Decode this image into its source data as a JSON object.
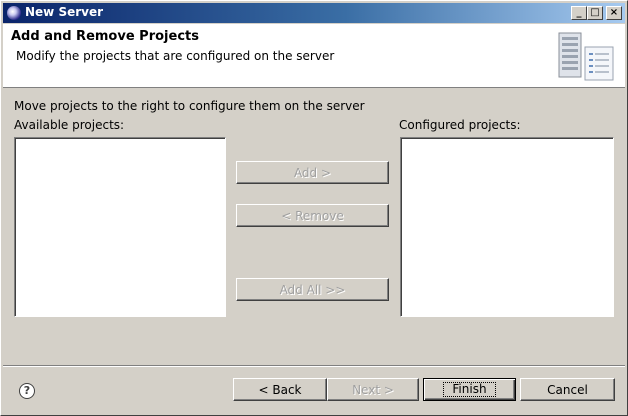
{
  "window": {
    "title": "New Server",
    "controls": {
      "minimize": "_",
      "maximize": "□",
      "close": "×"
    }
  },
  "header": {
    "title": "Add and Remove Projects",
    "description": "Modify the projects that are configured on the server",
    "banner_icon": "server-icon"
  },
  "main": {
    "instruction": "Move projects to the right to configure them on the server",
    "available_label": "Available projects:",
    "configured_label": "Configured projects:",
    "available_items": [],
    "configured_items": []
  },
  "transfer_buttons": {
    "add": "Add >",
    "remove": "< Remove",
    "add_all": "Add All >>"
  },
  "footer": {
    "help_icon": "help-icon",
    "back": "< Back",
    "next": "Next >",
    "finish": "Finish",
    "cancel": "Cancel"
  }
}
